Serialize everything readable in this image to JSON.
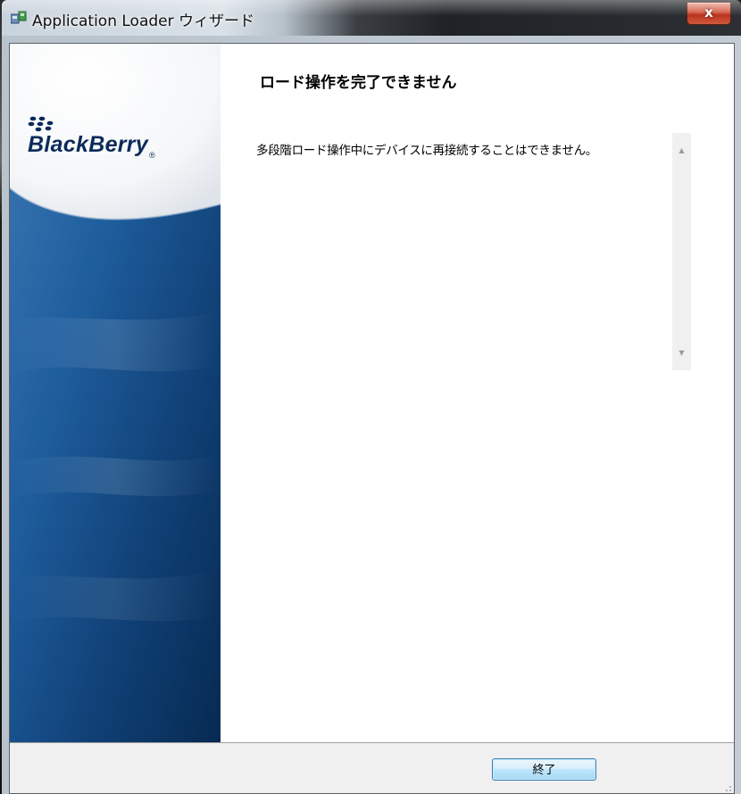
{
  "window": {
    "title": "Application Loader ウィザード",
    "close_label": "x",
    "icon": "application-loader-icon"
  },
  "banner": {
    "brand": "BlackBerry",
    "registered_mark": "®"
  },
  "content": {
    "heading": "ロード操作を完了できません",
    "message": "多段階ロード操作中にデバイスに再接続することはできません。"
  },
  "footer": {
    "finish_label": "終了"
  },
  "colors": {
    "accent": "#3c7fb1",
    "banner_blue": "#0e4a86",
    "brand_navy": "#0b2a5a"
  }
}
